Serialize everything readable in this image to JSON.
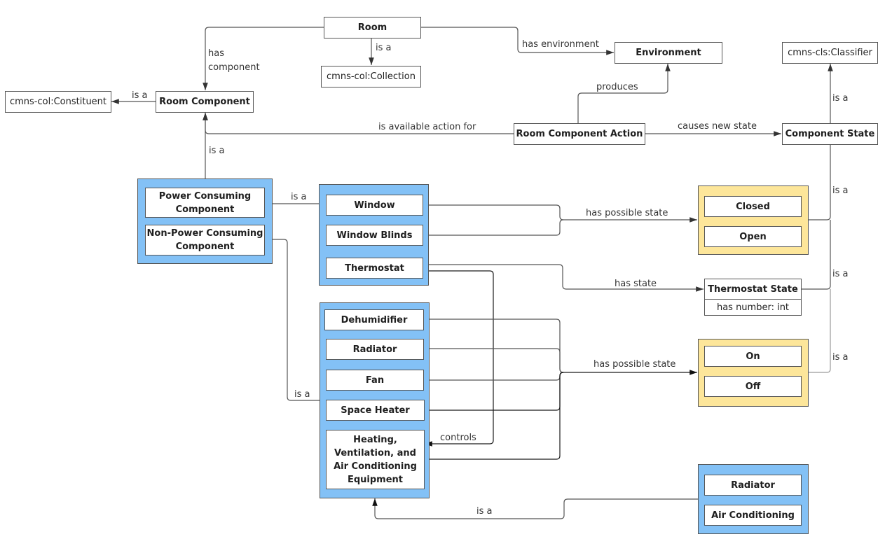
{
  "diagram": {
    "type": "ontology-class-diagram",
    "colors": {
      "group_blue": "#83c1f6",
      "group_yellow": "#fde69a",
      "node_bg": "#ffffff",
      "edge": "#555555"
    },
    "nodes": {
      "room": "Room",
      "collection": "cmns-col:Collection",
      "environment": "Environment",
      "classifier": "cmns-cls:Classifier",
      "constituent": "cmns-col:Constituent",
      "room_component": "Room Component",
      "room_component_action": "Room Component Action",
      "component_state": "Component State",
      "power_consuming": "Power Consuming Component",
      "non_power_consuming": "Non-Power Consuming Component",
      "window": "Window",
      "window_blinds": "Window Blinds",
      "thermostat": "Thermostat",
      "closed": "Closed",
      "open": "Open",
      "thermostat_state": "Thermostat State",
      "thermostat_state_attr": "has number: int",
      "dehumidifier": "Dehumidifier",
      "radiator": "Radiator",
      "fan": "Fan",
      "space_heater": "Space Heater",
      "hvac": "Heating, Ventilation, and Air Conditioning Equipment",
      "on": "On",
      "off": "Off",
      "radiator2": "Radiator",
      "air_conditioning": "Air Conditioning"
    },
    "edge_labels": {
      "has_component": "has\ncomponent",
      "room_is_a": "is a",
      "has_environment": "has environment",
      "component_is_a_constituent": "is a",
      "produces": "produces",
      "classifier_is_a": "is a",
      "is_available_action_for": "is available action for",
      "causes_new_state": "causes new state",
      "power_is_a": "is a",
      "window_group_is_a": "is a",
      "window_has_possible_state": "has possible state",
      "open_closed_is_a": "is a",
      "has_state": "has state",
      "thermostat_state_is_a": "is a",
      "onoff_is_a": "is a",
      "appliances_has_possible_state": "has possible state",
      "appliances_is_a": "is a",
      "controls": "controls",
      "hvac_subtypes_is_a": "is a"
    }
  }
}
